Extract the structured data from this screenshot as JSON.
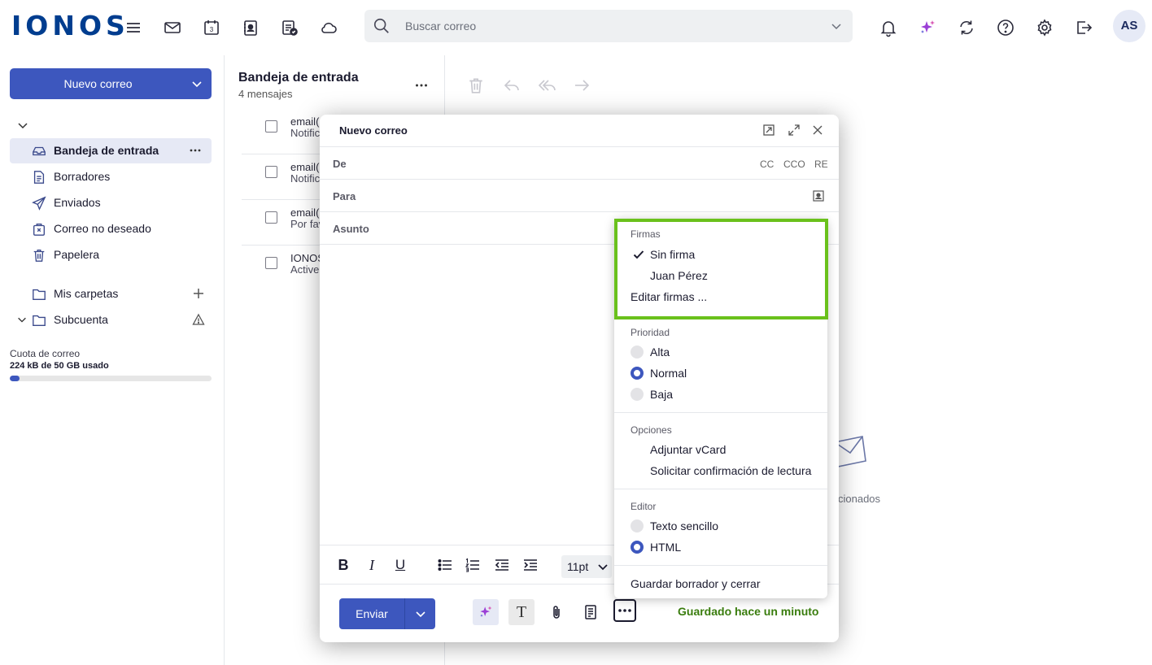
{
  "app": {
    "logo": "IONOS",
    "avatar_initials": "AS",
    "brand_color": "#3d57be",
    "accent_green": "#6ac11c"
  },
  "topbar": {
    "icons": [
      "menu-icon",
      "mail-icon",
      "calendar-icon",
      "contacts-icon",
      "tasks-icon",
      "cloud-icon",
      "notifications-icon",
      "ai-sparkle-icon",
      "sync-icon",
      "help-icon",
      "settings-icon",
      "logout-icon"
    ],
    "calendar_day": "3",
    "search": {
      "placeholder": "Buscar correo"
    }
  },
  "sidebar": {
    "new_mail_label": "Nuevo correo",
    "folders": [
      {
        "label": "Bandeja de entrada",
        "icon": "inbox-icon",
        "active": true
      },
      {
        "label": "Borradores",
        "icon": "draft-icon"
      },
      {
        "label": "Enviados",
        "icon": "sent-icon"
      },
      {
        "label": "Correo no deseado",
        "icon": "spam-icon"
      },
      {
        "label": "Papelera",
        "icon": "trash-icon"
      }
    ],
    "my_folders_label": "Mis carpetas",
    "subaccount_label": "Subcuenta",
    "quota": {
      "label": "Cuota de correo",
      "value": "224 kB de 50 GB usado",
      "fraction": 0.05
    }
  },
  "message_list": {
    "title": "Bandeja de entrada",
    "count": "4 mensajes",
    "messages": [
      {
        "line1": "email(",
        "line2": "Notific"
      },
      {
        "line1": "email(",
        "line2": "Notific"
      },
      {
        "line1": "email(",
        "line2": "Por fav"
      },
      {
        "line1": "IONOS",
        "line2": "Active"
      }
    ]
  },
  "reader": {
    "empty_text": "cionados",
    "toolbar_icons": [
      "delete-icon",
      "reply-icon",
      "reply-all-icon",
      "forward-icon"
    ]
  },
  "compose": {
    "title": "Nuevo correo",
    "from_label": "De",
    "to_label": "Para",
    "subject_label": "Asunto",
    "cc": "CC",
    "bcc": "CCO",
    "reply_to": "RE",
    "font_size": "11pt",
    "format_buttons": [
      "B",
      "I",
      "U"
    ],
    "send_label": "Enviar",
    "template_glyph": "T",
    "saved_status": "Guardado hace un minuto"
  },
  "options_menu": {
    "signatures_header": "Firmas",
    "signatures": [
      {
        "label": "Sin firma",
        "checked": true
      },
      {
        "label": "Juan Pérez",
        "checked": false
      }
    ],
    "edit_signatures": "Editar firmas ...",
    "priority_header": "Prioridad",
    "priorities": [
      {
        "label": "Alta",
        "selected": false
      },
      {
        "label": "Normal",
        "selected": true
      },
      {
        "label": "Baja",
        "selected": false
      }
    ],
    "options_header": "Opciones",
    "options": [
      "Adjuntar vCard",
      "Solicitar confirmación de lectura"
    ],
    "editor_header": "Editor",
    "editors": [
      {
        "label": "Texto sencillo",
        "selected": false
      },
      {
        "label": "HTML",
        "selected": true
      }
    ],
    "save_close": "Guardar borrador y cerrar"
  }
}
